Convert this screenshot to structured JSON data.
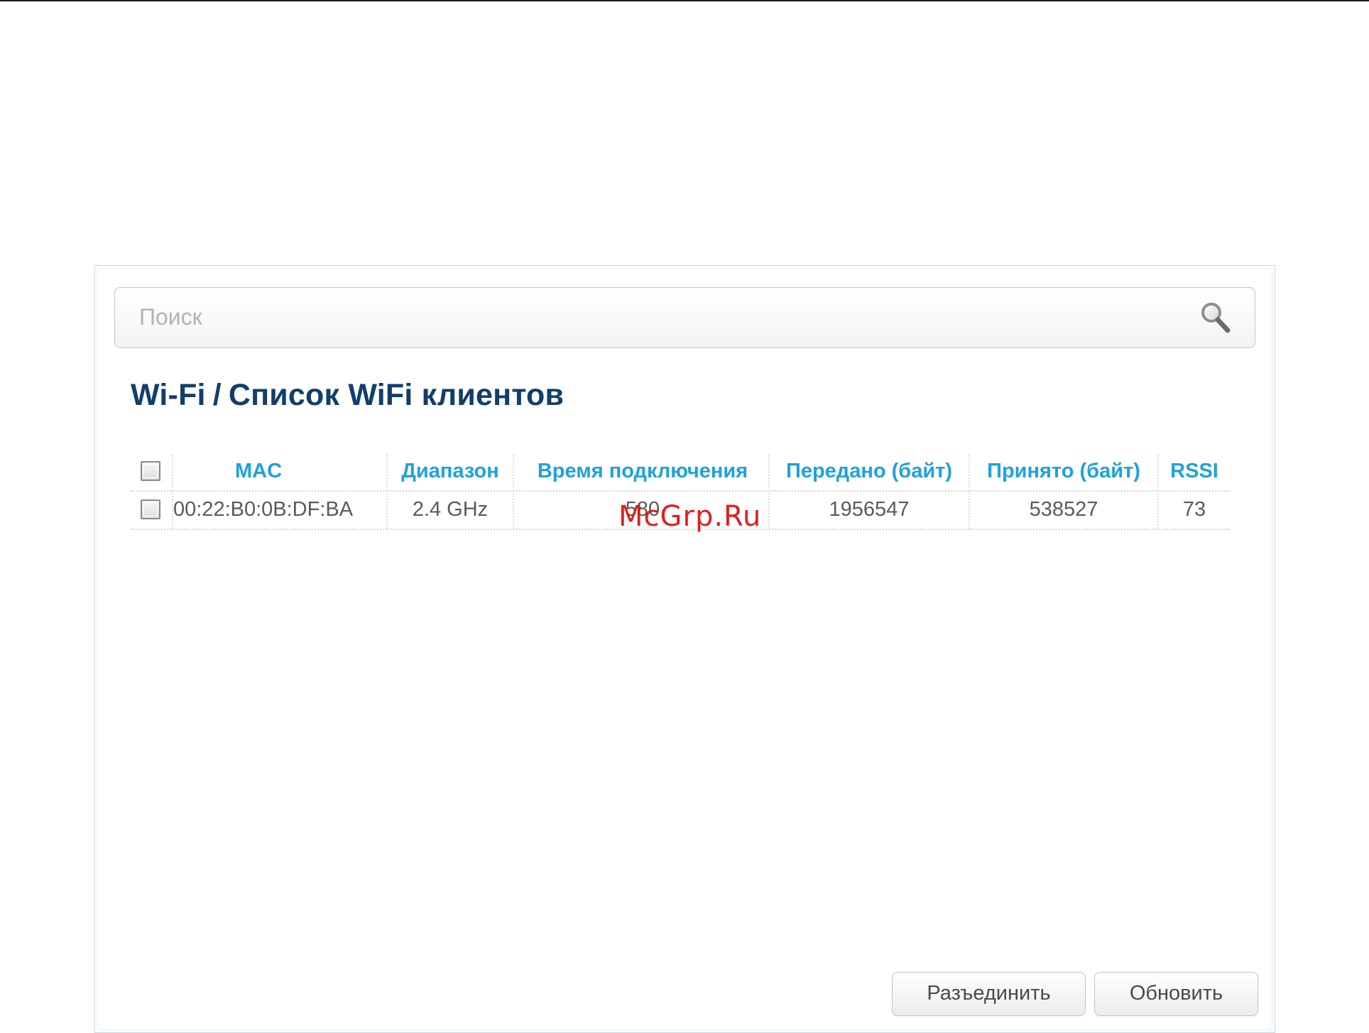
{
  "search": {
    "placeholder": "Поиск",
    "value": ""
  },
  "breadcrumb": {
    "section": "Wi-Fi",
    "separator": "/",
    "page": "Список WiFi клиентов"
  },
  "table": {
    "headers": [
      "MAC",
      "Диапазон",
      "Время подключения",
      "Передано (байт)",
      "Принято (байт)",
      "RSSI"
    ],
    "rows": [
      {
        "checked": false,
        "mac": "00:22:B0:0B:DF:BA",
        "band": "2.4 GHz",
        "connection_time": "580",
        "sent_bytes": "1956547",
        "received_bytes": "538527",
        "rssi": "73"
      }
    ]
  },
  "watermark": "McGrp.Ru",
  "buttons": {
    "disconnect": "Разъединить",
    "refresh": "Обновить"
  },
  "colors": {
    "title": "#123e6b",
    "header": "#1ea2dc",
    "watermark": "#e01313"
  }
}
